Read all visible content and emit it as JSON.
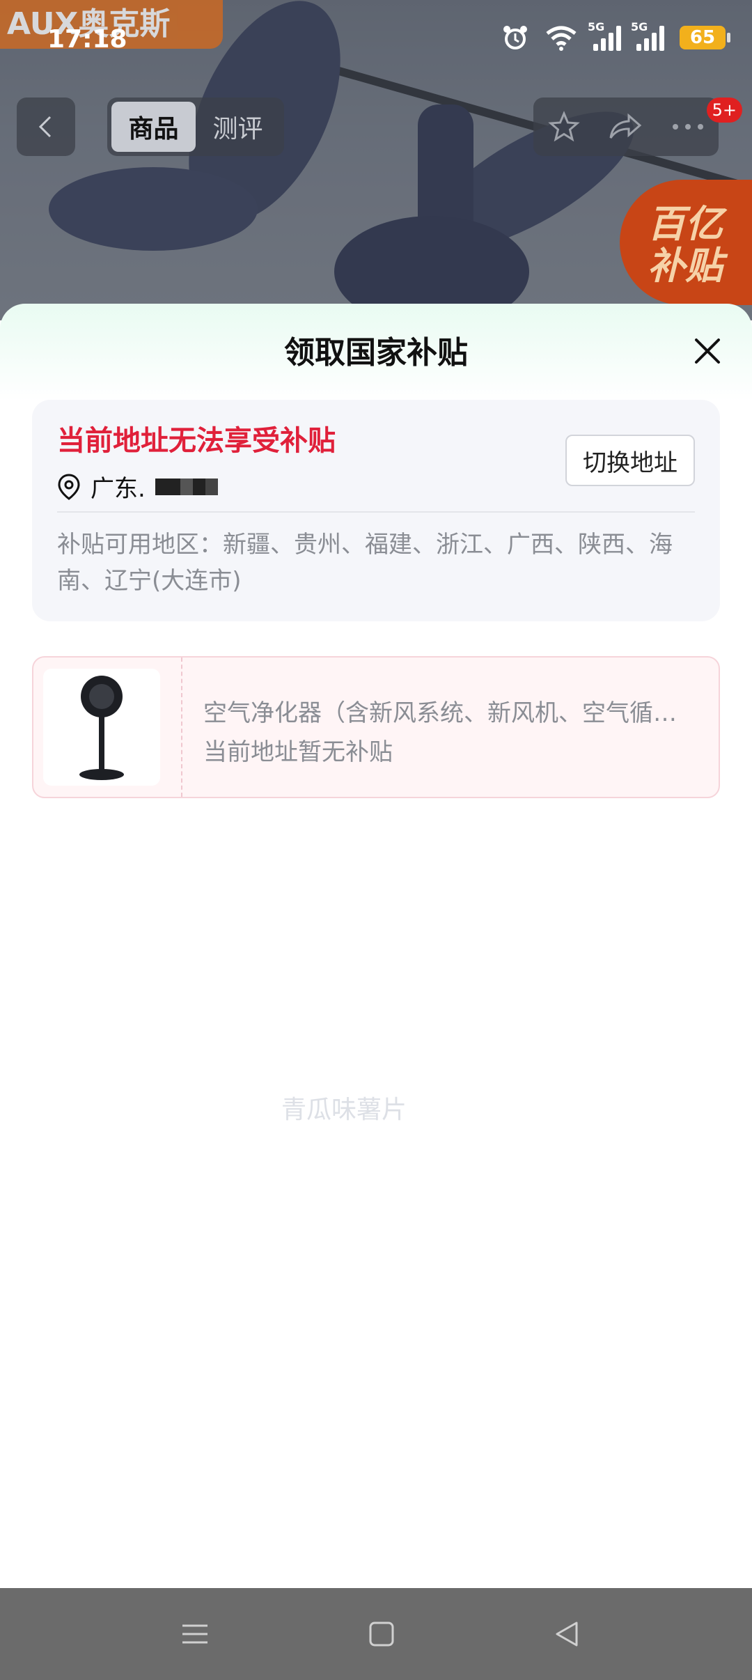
{
  "status_bar": {
    "time": "17:18",
    "signal1_label": "5G",
    "signal2_label": "5G",
    "battery": "65"
  },
  "hero": {
    "brand_text": "AUX奥克斯",
    "promo_line1": "百亿",
    "promo_line2": "补贴"
  },
  "nav": {
    "tabs": [
      {
        "label": "商品",
        "active": true
      },
      {
        "label": "测评",
        "active": false
      }
    ],
    "badge": "5+"
  },
  "sheet": {
    "title": "领取国家补贴",
    "address": {
      "warning": "当前地址无法享受补贴",
      "location": "广东.",
      "switch_button": "切换地址",
      "regions_text": "补贴可用地区：新疆、贵州、福建、浙江、广西、陕西、海南、辽宁(大连市)"
    },
    "product": {
      "name": "空气净化器（含新风系统、新风机、空气循环扇）",
      "status": "当前地址暂无补贴"
    },
    "watermark": "青瓜味薯片"
  },
  "colors": {
    "warning": "#e0203a",
    "sheet_top_tint": "#e9fbf2",
    "battery": "#f2b01c"
  }
}
